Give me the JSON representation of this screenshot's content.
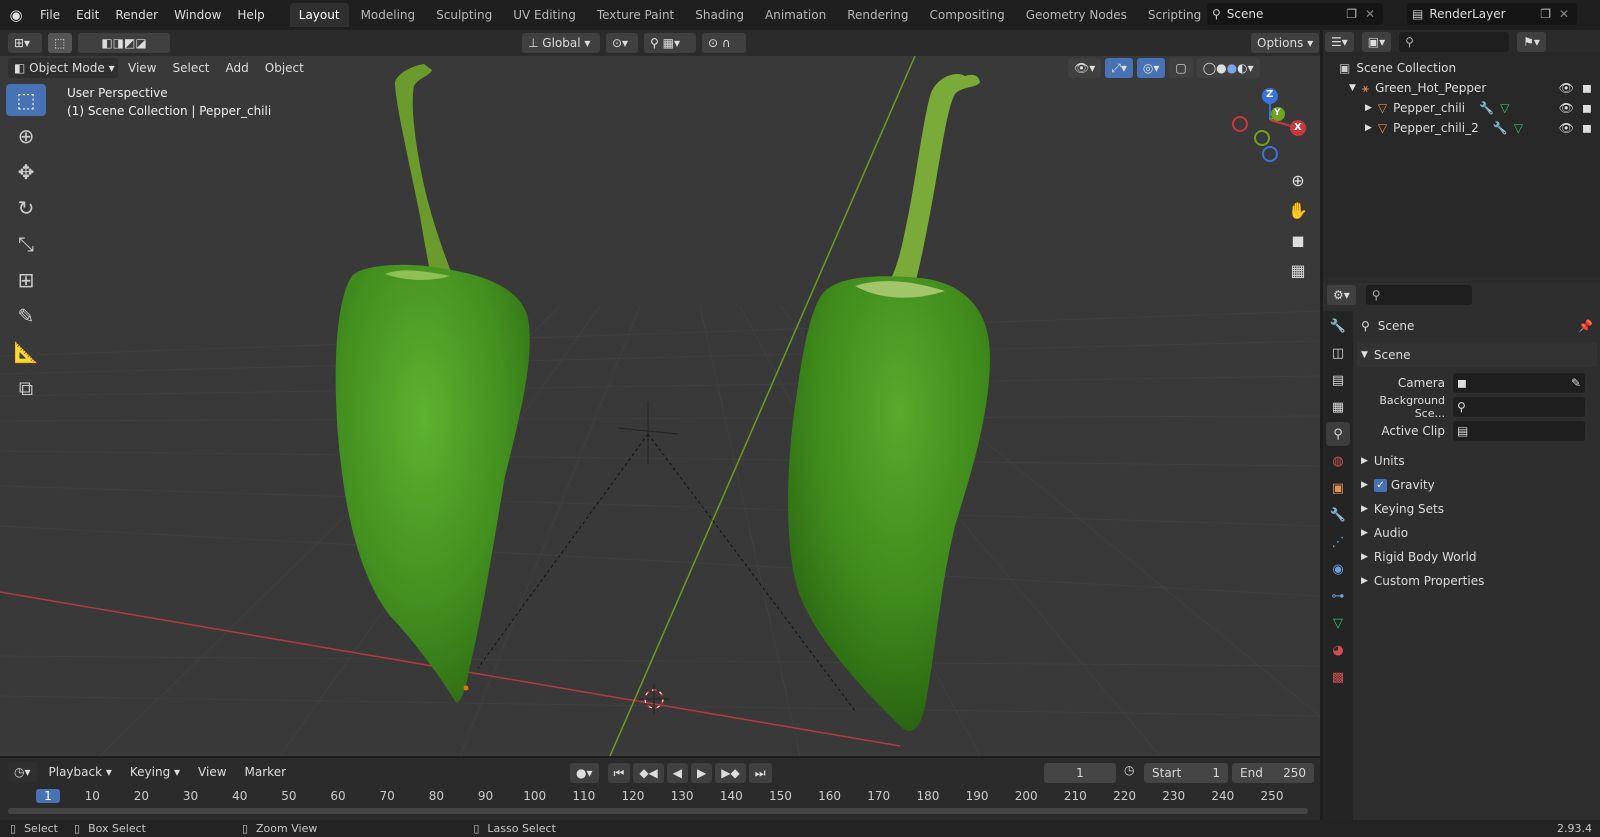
{
  "menubar": {
    "items": [
      "File",
      "Edit",
      "Render",
      "Window",
      "Help"
    ],
    "workspaces": [
      "Layout",
      "Modeling",
      "Sculpting",
      "UV Editing",
      "Texture Paint",
      "Shading",
      "Animation",
      "Rendering",
      "Compositing",
      "Geometry Nodes",
      "Scripting"
    ],
    "active_workspace": "Layout",
    "scene": "Scene",
    "render_layer": "RenderLayer"
  },
  "viewport_header": {
    "mode": "Object Mode",
    "menus": [
      "View",
      "Select",
      "Add",
      "Object"
    ],
    "orientation": "Global",
    "options": "Options"
  },
  "viewport": {
    "perspective": "User Perspective",
    "collection_info": "(1) Scene Collection | Pepper_chili",
    "gizmo_labels": {
      "z": "Z",
      "y": "Y",
      "x": "X"
    }
  },
  "outliner": {
    "root": "Scene Collection",
    "items": [
      {
        "name": "Green_Hot_Pepper",
        "icon": "empty-icon"
      },
      {
        "name": "Pepper_chili",
        "icon": "mesh-icon"
      },
      {
        "name": "Pepper_chili_2",
        "icon": "mesh-icon"
      }
    ]
  },
  "properties": {
    "context": "Scene",
    "panel_title": "Scene",
    "fields": [
      {
        "label": "Camera",
        "value": ""
      },
      {
        "label": "Background Sce...",
        "value": ""
      },
      {
        "label": "Active Clip",
        "value": ""
      }
    ],
    "panels": [
      "Units",
      "Gravity",
      "Keying Sets",
      "Audio",
      "Rigid Body World",
      "Custom Properties"
    ],
    "gravity_checked": true
  },
  "timeline": {
    "menus": [
      "Playback",
      "Keying",
      "View",
      "Marker"
    ],
    "current_frame": "1",
    "start_label": "Start",
    "start": "1",
    "end_label": "End",
    "end": "250",
    "ruler": [
      "1",
      "10",
      "20",
      "30",
      "40",
      "50",
      "60",
      "70",
      "80",
      "90",
      "100",
      "110",
      "120",
      "130",
      "140",
      "150",
      "160",
      "170",
      "180",
      "190",
      "200",
      "210",
      "220",
      "230",
      "240",
      "250"
    ]
  },
  "statusbar": {
    "select": "Select",
    "box_select": "Box Select",
    "zoom_view": "Zoom View",
    "lasso_select": "Lasso Select",
    "version": "2.93.4"
  },
  "colors": {
    "accent": "#4772b3",
    "pepper": "#4c9a22",
    "x_axis": "#c9383f",
    "y_axis": "#6fa31f",
    "z_axis": "#3b74d8"
  }
}
